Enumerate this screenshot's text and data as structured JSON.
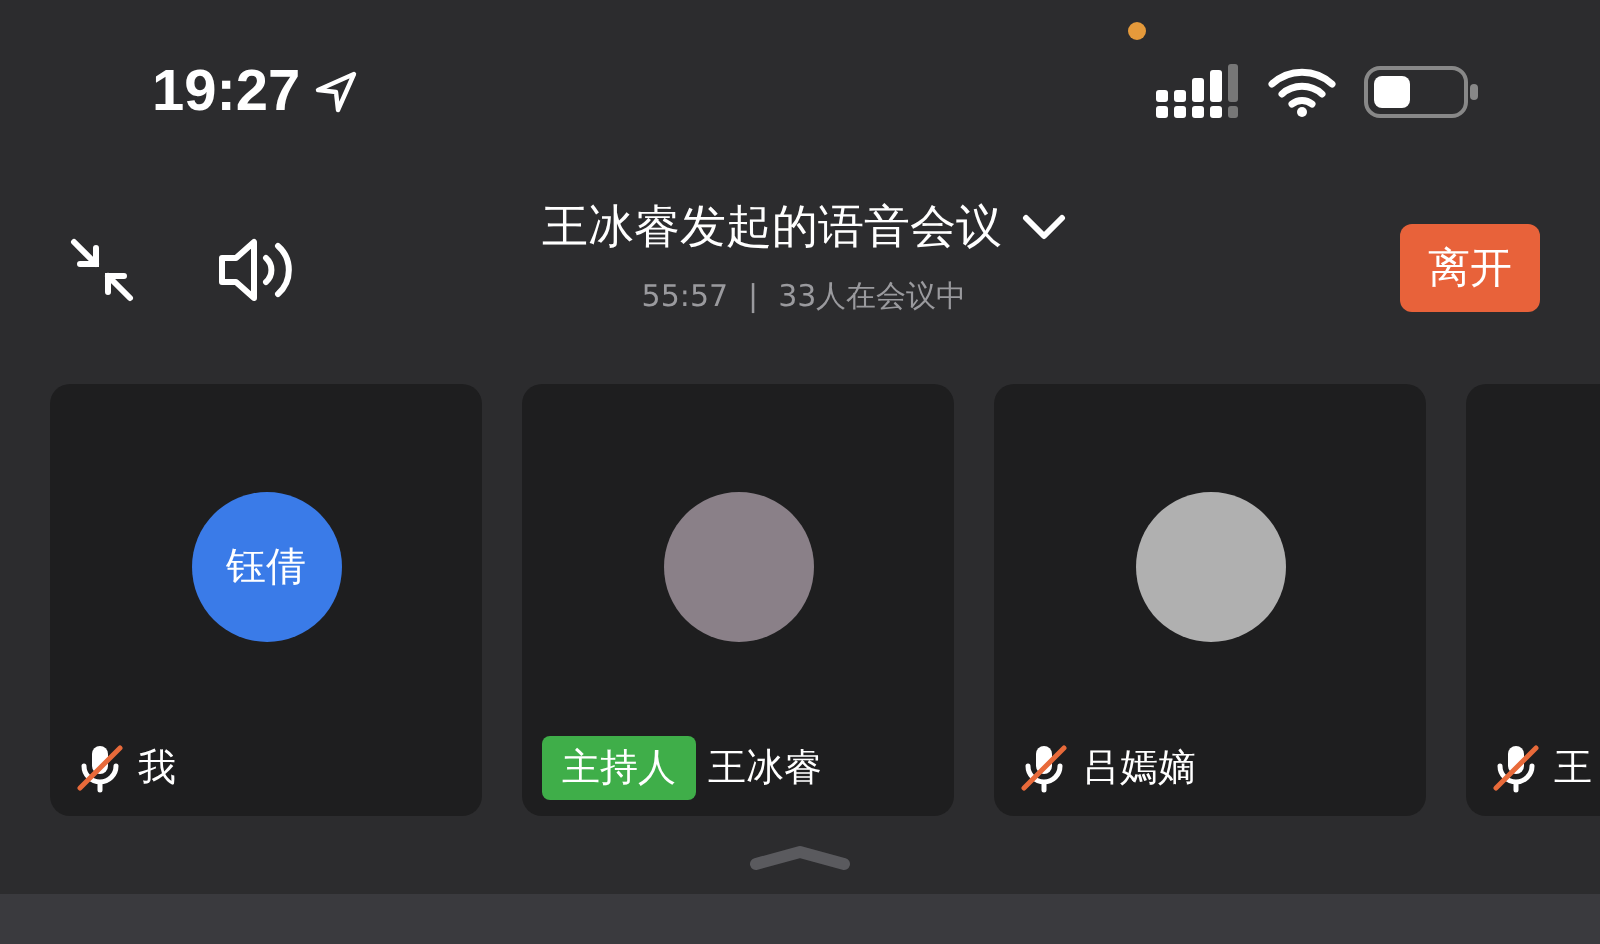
{
  "status_bar": {
    "time": "19:27"
  },
  "header": {
    "title": "王冰睿发起的语音会议",
    "duration": "55:57",
    "separator": "|",
    "attendance": "33人在会议中",
    "leave_button": "离开"
  },
  "participants": [
    {
      "name": "我",
      "muted": true,
      "avatar": {
        "kind": "initials",
        "text": "钰倩"
      }
    },
    {
      "name": "王冰睿",
      "muted": false,
      "badge": "主持人",
      "avatar": {
        "kind": "photo"
      }
    },
    {
      "name": "吕嫣嫡",
      "muted": true,
      "avatar": {
        "kind": "photo"
      }
    },
    {
      "name": "王",
      "muted": true
    }
  ]
}
